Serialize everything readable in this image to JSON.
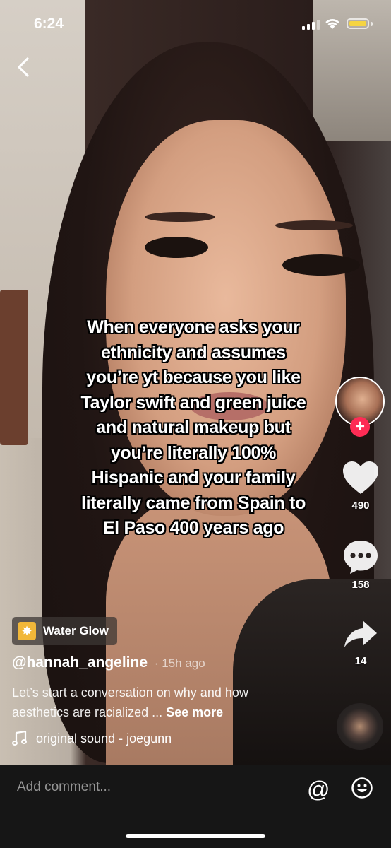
{
  "status_bar": {
    "time": "6:24"
  },
  "video": {
    "caption_lines": [
      "When everyone asks your",
      "ethnicity and assumes",
      "you’re yt because you like",
      "Taylor swift and green juice",
      "and natural makeup but",
      "you’re literally 100%",
      "Hispanic and your family",
      "literally came from Spain to",
      "El Paso 400 years ago"
    ]
  },
  "actions": {
    "likes": "490",
    "comments": "158",
    "shares": "14",
    "follow_label": "+"
  },
  "effect": {
    "label": "Water Glow"
  },
  "post": {
    "username": "@hannah_angeline",
    "time_ago": "· 15h ago",
    "description": "Let’s start a conversation on why and how aesthetics are racialized ...",
    "see_more": "See more",
    "sound": "original sound - joegunn"
  },
  "comment_bar": {
    "placeholder": "Add comment...",
    "mention_symbol": "@"
  },
  "icons": [
    "back-icon",
    "heart-icon",
    "comment-icon",
    "share-icon",
    "music-note-icon",
    "emoji-icon",
    "signal-icon",
    "wifi-icon",
    "battery-icon"
  ],
  "colors": {
    "follow_accent": "#fe2c55",
    "battery_fill": "#f5d442",
    "effect_icon": "#f1b739"
  }
}
